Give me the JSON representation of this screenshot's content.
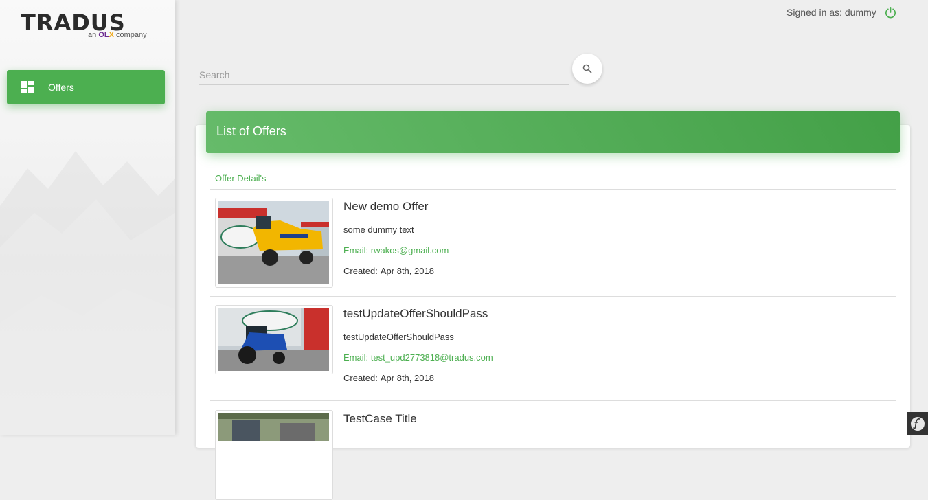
{
  "brand": {
    "logo_text": "TRADUS",
    "tagline_prefix": "an",
    "tagline_olx": "OL",
    "tagline_olx_x": "X",
    "tagline_suffix": "company"
  },
  "sidebar": {
    "items": [
      {
        "label": "Offers",
        "icon": "dashboard-icon",
        "active": true
      }
    ]
  },
  "header": {
    "signed_in_text": "Signed in as: dummy",
    "logout_icon": "power-icon"
  },
  "search": {
    "placeholder": "Search",
    "value": "",
    "button_icon": "search-icon"
  },
  "offers_card": {
    "title": "List of Offers",
    "column_header": "Offer Detail's",
    "items": [
      {
        "title": "New demo Offer",
        "description": "some dummy text",
        "email_label": "Email:",
        "email": "rwakos@gmail.com",
        "created_label": "Created:",
        "created": "Apr 8th, 2018",
        "image": "combine-harvester-photo"
      },
      {
        "title": "testUpdateOfferShouldPass",
        "description": "testUpdateOfferShouldPass",
        "email_label": "Email:",
        "email": "test_upd2773818@tradus.com",
        "created_label": "Created:",
        "created": "Apr 8th, 2018",
        "image": "tractor-photo"
      },
      {
        "title": "TestCase Title",
        "image": "vehicle-photo"
      }
    ]
  },
  "colors": {
    "accent": "#4caf50",
    "header_gradient_start": "#66bb6a",
    "header_gradient_end": "#43a047"
  }
}
